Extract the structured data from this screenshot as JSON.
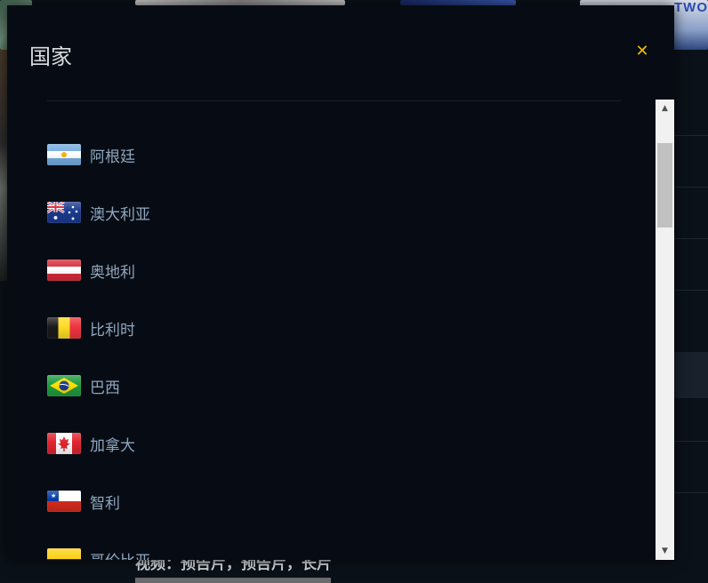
{
  "background": {
    "thumbnail_text": "TWO",
    "bottom_text": "视频：预告片，预告片，长片"
  },
  "modal": {
    "title": "国家",
    "close_icon": "close-icon",
    "accent_color": "#f2b705",
    "countries": [
      {
        "name": "阿根廷",
        "flag": "argentina-flag-icon"
      },
      {
        "name": "澳大利亚",
        "flag": "australia-flag-icon"
      },
      {
        "name": "奥地利",
        "flag": "austria-flag-icon"
      },
      {
        "name": "比利时",
        "flag": "belgium-flag-icon"
      },
      {
        "name": "巴西",
        "flag": "brazil-flag-icon"
      },
      {
        "name": "加拿大",
        "flag": "canada-flag-icon"
      },
      {
        "name": "智利",
        "flag": "chile-flag-icon"
      },
      {
        "name": "哥伦比亚",
        "flag": "colombia-flag-icon"
      }
    ]
  }
}
